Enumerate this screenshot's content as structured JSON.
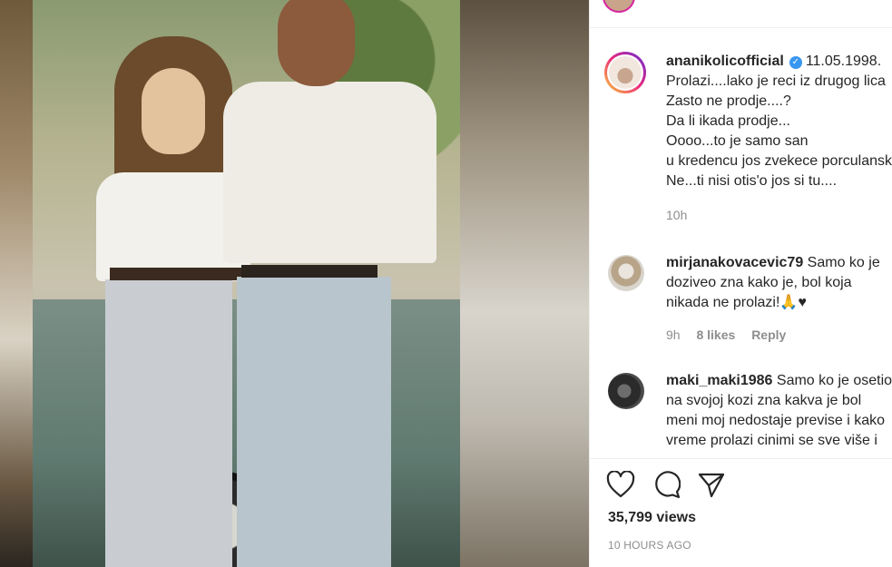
{
  "post": {
    "author": {
      "username": "ananikolicofficial",
      "verified_icon": "verified-badge-icon",
      "date_text": "11.05.1998."
    },
    "caption_lines": [
      "Prolazi....lako je reci iz drugog lica",
      "Zasto ne prodje....?",
      "Da li ikada prodje...",
      "Oooo...to je samo san",
      "u kredencu jos zvekece porculanski",
      "Ne...ti nisi otis'o jos si tu...."
    ],
    "caption_time": "10h"
  },
  "comments": [
    {
      "username": "mirjanakovacevic79",
      "lines": [
        "Samo ko je",
        "doziveo zna kako je, bol koja",
        "nikada ne prolazi!🙏"
      ],
      "trailing_icon": "black-heart-icon",
      "trailing_glyph": "♥",
      "time": "9h",
      "likes": "8 likes",
      "reply": "Reply"
    },
    {
      "username": "maki_maki1986",
      "lines": [
        "Samo ko je osetio",
        "na svojoj kozi zna kakva je bol",
        "meni moj nedostaje previse i kako",
        "vreme prolazi cinimi se sve više i"
      ]
    }
  ],
  "actions": {
    "like_icon": "heart-outline-icon",
    "comment_icon": "comment-bubble-icon",
    "share_icon": "paper-plane-icon"
  },
  "stats": {
    "views": "35,799 views",
    "time_ago": "10 HOURS AGO"
  },
  "colors": {
    "text": "#262626",
    "muted": "#8e8e8e",
    "verified": "#3897f0",
    "divider": "#efefef"
  }
}
